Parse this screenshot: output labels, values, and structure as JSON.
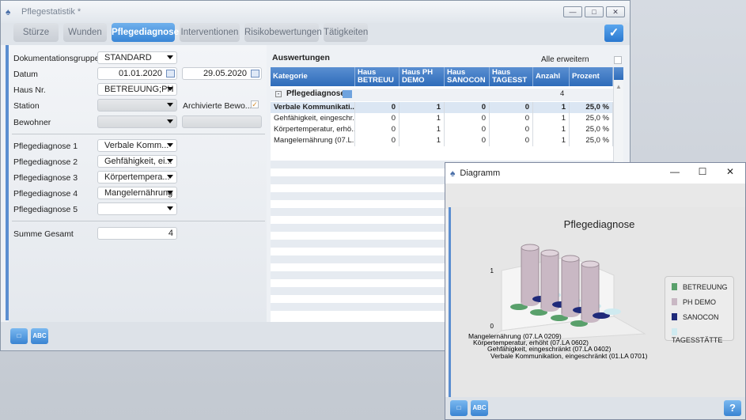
{
  "window": {
    "title": "Pflegestatistik *"
  },
  "tabs": [
    "Stürze",
    "Wunden",
    "Pflegediagnosen",
    "Interventionen",
    "Risikobewertungen",
    "Tätigkeiten"
  ],
  "active_tab": "Pflegediagnosen",
  "form": {
    "dokgruppe_label": "Dokumentationsgruppe",
    "dokgruppe_value": "STANDARD",
    "datum_label": "Datum",
    "date_from": "01.01.2020",
    "date_to": "29.05.2020",
    "haus_label": "Haus Nr.",
    "haus_value": "BETREUUNG;PH D",
    "station_label": "Station",
    "archiv_label": "Archivierte Bewo...",
    "bewohner_label": "Bewohner",
    "pd1_label": "Pflegediagnose 1",
    "pd1_value": "Verbale Komm...",
    "pd2_label": "Pflegediagnose 2",
    "pd2_value": "Gehfähigkeit, ei...",
    "pd3_label": "Pflegediagnose 3",
    "pd3_value": "Körpertempera...",
    "pd4_label": "Pflegediagnose 4",
    "pd4_value": "Mangelernährung",
    "pd5_label": "Pflegediagnose 5",
    "pd5_value": "",
    "summe_label": "Summe Gesamt",
    "summe_value": "4"
  },
  "auswertung": {
    "title": "Auswertungen",
    "expand_all": "Alle erweitern",
    "headers": [
      {
        "l1": "Kategorie",
        "l2": ""
      },
      {
        "l1": "Haus",
        "l2": "BETREUU"
      },
      {
        "l1": "Haus PH",
        "l2": "DEMO"
      },
      {
        "l1": "Haus",
        "l2": "SANOCON"
      },
      {
        "l1": "Haus",
        "l2": "TAGESST"
      },
      {
        "l1": "Anzahl",
        "l2": ""
      },
      {
        "l1": "Prozent",
        "l2": ""
      }
    ],
    "group": {
      "label": "Pflegediagnose",
      "count": "4"
    },
    "rows": [
      {
        "k": "Verbale Kommunikati...",
        "a": "0",
        "b": "1",
        "c": "0",
        "d": "0",
        "n": "1",
        "p": "25,0 %"
      },
      {
        "k": "Gehfähigkeit, eingeschr...",
        "a": "0",
        "b": "1",
        "c": "0",
        "d": "0",
        "n": "1",
        "p": "25,0 %"
      },
      {
        "k": "Körpertemperatur, erhö...",
        "a": "0",
        "b": "1",
        "c": "0",
        "d": "0",
        "n": "1",
        "p": "25,0 %"
      },
      {
        "k": "Mangelernährung (07.L...",
        "a": "0",
        "b": "1",
        "c": "0",
        "d": "0",
        "n": "1",
        "p": "25,0 %"
      }
    ]
  },
  "footer": {
    "abc_label": "ABC"
  },
  "dialog": {
    "title": "Diagramm",
    "help": "?"
  },
  "chart_data": {
    "type": "bar",
    "title": "Pflegediagnose",
    "categories": [
      "Mangelernährung (07.LA 0209)",
      "Körpertemperatur, erhöht (07.LA 0602)",
      "Gehfähigkeit, eingeschränkt (07.LA 0402)",
      "Verbale Kommunikation, eingeschränkt (01.LA 0701)"
    ],
    "series": [
      {
        "name": "BETREUUNG",
        "values": [
          0,
          0,
          0,
          0
        ],
        "color": "#59a06b"
      },
      {
        "name": "PH DEMO",
        "values": [
          1,
          1,
          1,
          1
        ],
        "color": "#c9b8c4"
      },
      {
        "name": "SANOCON",
        "values": [
          0,
          0,
          0,
          0
        ],
        "color": "#1f2a7a"
      },
      {
        "name": "TAGESSTÄTTE",
        "values": [
          0,
          0,
          0,
          0
        ],
        "color": "#cfeaf0"
      }
    ],
    "yticks": [
      "0",
      "1"
    ],
    "ylim": [
      0,
      1
    ],
    "legend_position": "right"
  }
}
